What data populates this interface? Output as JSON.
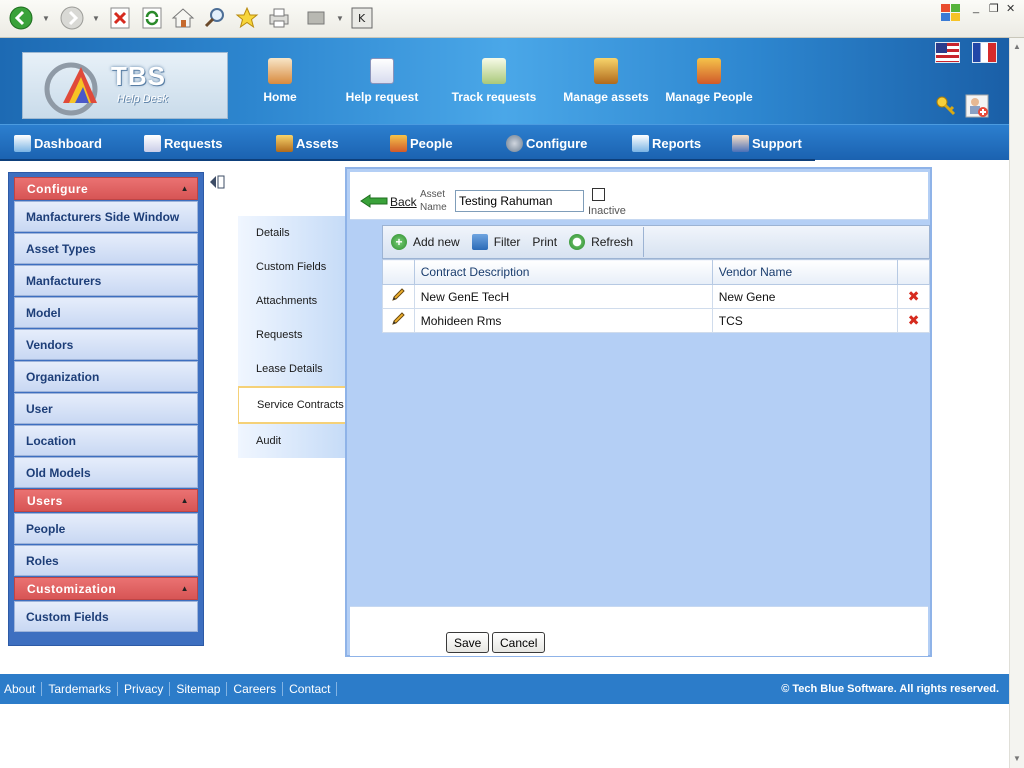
{
  "header": {
    "logo_text": "TBS",
    "logo_sub": "Help Desk",
    "nav": [
      {
        "label": "Home"
      },
      {
        "label": "Help request"
      },
      {
        "label": "Track requests"
      },
      {
        "label": "Manage assets"
      },
      {
        "label": "Manage People"
      }
    ]
  },
  "menu": {
    "items": [
      {
        "label": "Dashboard"
      },
      {
        "label": "Requests"
      },
      {
        "label": "Assets"
      },
      {
        "label": "People"
      },
      {
        "label": "Configure"
      },
      {
        "label": "Reports"
      },
      {
        "label": "Support"
      }
    ]
  },
  "sidebar": {
    "sections": [
      {
        "title": "Configure",
        "items": [
          "Manfacturers Side Window",
          "Asset Types",
          "Manfacturers",
          "Model",
          "Vendors",
          "Organization",
          "User",
          "Location",
          "Old Models"
        ]
      },
      {
        "title": "Users",
        "items": [
          "People",
          "Roles"
        ]
      },
      {
        "title": "Customization",
        "items": [
          "Custom Fields"
        ]
      }
    ]
  },
  "tabs": {
    "items": [
      "Details",
      "Custom Fields",
      "Attachments",
      "Requests",
      "Lease Details",
      "Service Contracts",
      "Audit"
    ],
    "active": "Service Contracts"
  },
  "form": {
    "back_label": "Back",
    "asset_label_1": "Asset",
    "asset_label_2": "Name",
    "asset_name_value": "Testing Rahuman",
    "inactive_label": "Inactive",
    "save_label": "Save",
    "cancel_label": "Cancel"
  },
  "grid": {
    "toolbar": {
      "add": "Add new",
      "filter": "Filter",
      "print": "Print",
      "refresh": "Refresh"
    },
    "columns": [
      "Contract Description",
      "Vendor Name"
    ],
    "rows": [
      {
        "description": "New GenE TecH",
        "vendor": "New Gene"
      },
      {
        "description": "Mohideen Rms",
        "vendor": "TCS"
      }
    ]
  },
  "footer": {
    "links": [
      "About",
      "Tardemarks",
      "Privacy",
      "Sitemap",
      "Careers",
      "Contact"
    ],
    "copyright": "© Tech Blue Software. All rights reserved."
  },
  "colors": {
    "header_blue": "#2d86cf",
    "sidebar_head_red": "#d75555",
    "sidebar_bg": "#3d6fc0",
    "panel_bg": "#b4cff5",
    "footer_blue": "#2c7cc9"
  }
}
